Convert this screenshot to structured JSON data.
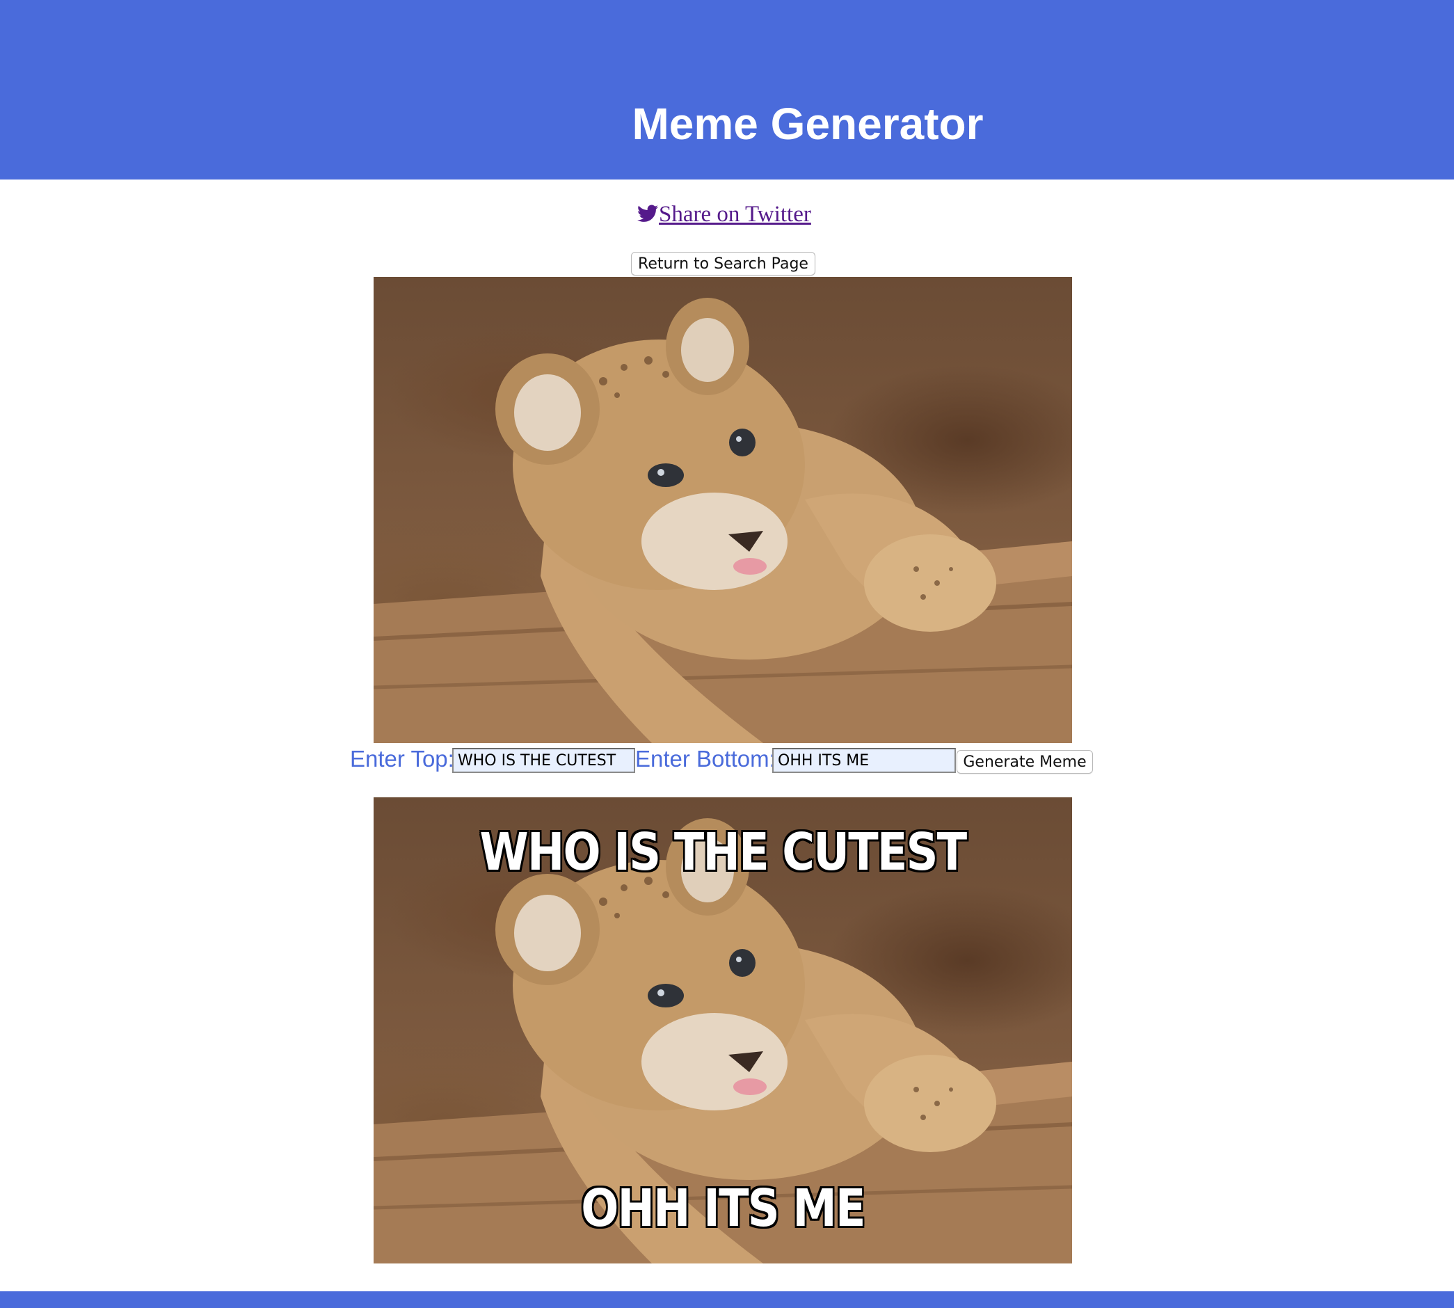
{
  "header": {
    "title": "Meme Generator"
  },
  "share": {
    "icon": "twitter-icon",
    "label": "Share on Twitter"
  },
  "actions": {
    "return_label": "Return to Search Page",
    "generate_label": "Generate Meme"
  },
  "form": {
    "top_label": "Enter Top:",
    "top_value": "WHO IS THE CUTEST",
    "bottom_label": "Enter Bottom:",
    "bottom_value": "OHH ITS ME"
  },
  "meme": {
    "top_text": "WHO IS THE CUTEST",
    "bottom_text": "OHH ITS ME"
  },
  "colors": {
    "accent": "#4a6bdb",
    "link": "#551a8b",
    "input_bg": "#e8f0fe"
  }
}
